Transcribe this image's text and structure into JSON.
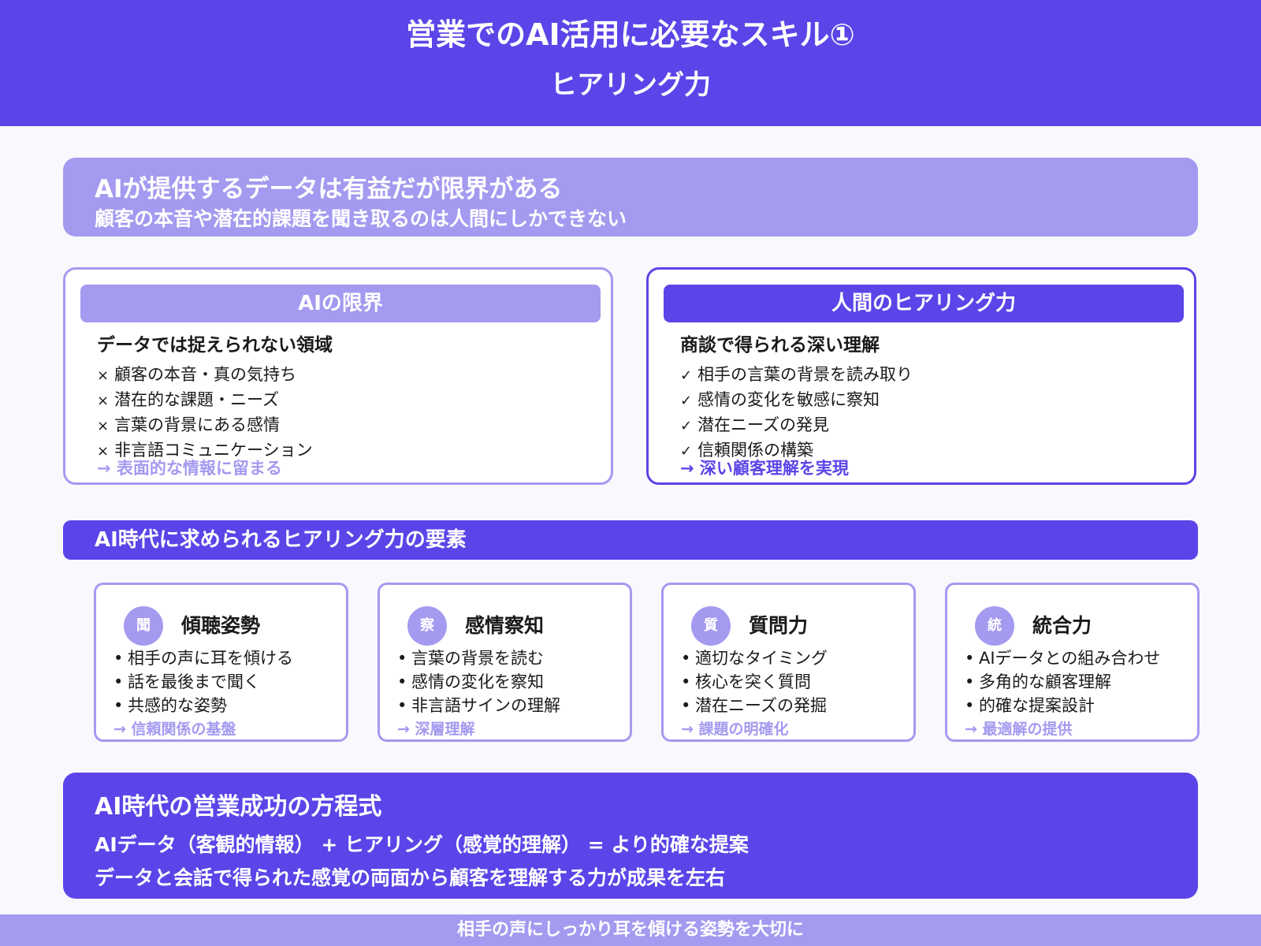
{
  "header": {
    "title": "営業でのAI活用に必要なスキル①",
    "subtitle": "ヒアリング力"
  },
  "banner": {
    "line1": "AIが提供するデータは有益だが限界がある",
    "line2": "顧客の本音や潜在的課題を聞き取るのは人間にしかできない"
  },
  "left_panel": {
    "title": "AIの限界",
    "subtitle": "データでは捉えられない領域",
    "marker": "×",
    "items": [
      "顧客の本音・真の気持ち",
      "潜在的な課題・ニーズ",
      "言葉の背景にある感情",
      "非言語コミュニケーション"
    ],
    "result": "→ 表面的な情報に留まる"
  },
  "right_panel": {
    "title": "人間のヒアリング力",
    "subtitle": "商談で得られる深い理解",
    "marker": "✓",
    "items": [
      "相手の言葉の背景を読み取り",
      "感情の変化を敏感に察知",
      "潜在ニーズの発見",
      "信頼関係の構築"
    ],
    "result": "→ 深い顧客理解を実現"
  },
  "section": {
    "title": "AI時代に求められるヒアリング力の要素"
  },
  "cards": [
    {
      "icon": "聞",
      "title": "傾聴姿勢",
      "items": [
        "相手の声に耳を傾ける",
        "話を最後まで聞く",
        "共感的な姿勢"
      ],
      "result": "→ 信頼関係の基盤"
    },
    {
      "icon": "察",
      "title": "感情察知",
      "items": [
        "言葉の背景を読む",
        "感情の変化を察知",
        "非言語サインの理解"
      ],
      "result": "→ 深層理解"
    },
    {
      "icon": "質",
      "title": "質問力",
      "items": [
        "適切なタイミング",
        "核心を突く質問",
        "潜在ニーズの発掘"
      ],
      "result": "→ 課題の明確化"
    },
    {
      "icon": "統",
      "title": "統合力",
      "items": [
        "AIデータとの組み合わせ",
        "多角的な顧客理解",
        "的確な提案設計"
      ],
      "result": "→ 最適解の提供"
    }
  ],
  "formula": {
    "title": "AI時代の営業成功の方程式",
    "line1": "AIデータ（客観的情報） + ヒアリング（感覚的理解） = より的確な提案",
    "line2": "データと会話で得られた感覚の両面から顧客を理解する力が成果を左右"
  },
  "footer": {
    "text": "相手の声にしっかり耳を傾ける姿勢を大切に"
  },
  "colors": {
    "primary": "#5b45e8",
    "light": "#a49af0",
    "background": "#f8f8fd"
  }
}
